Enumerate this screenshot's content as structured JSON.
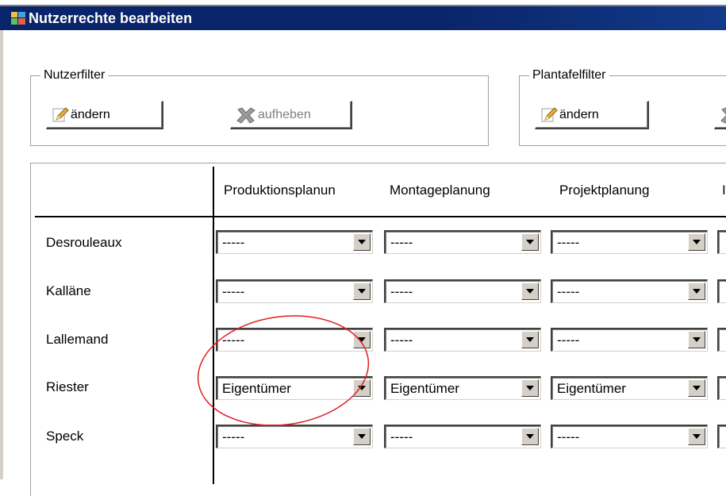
{
  "window": {
    "title": "Nutzerrechte bearbeiten",
    "icon": "app-grid-icon"
  },
  "filters": {
    "nutzerfilter": {
      "legend": "Nutzerfilter",
      "change_label": "ändern",
      "remove_label": "aufheben"
    },
    "plantafelfilter": {
      "legend": "Plantafelfilter",
      "change_label": "ändern"
    }
  },
  "grid": {
    "columns": [
      "Produktionsplanun",
      "Montageplanung",
      "Projektplanung"
    ],
    "rows": [
      {
        "name": "Desrouleaux",
        "values": [
          "-----",
          "-----",
          "-----"
        ]
      },
      {
        "name": "Kalläne",
        "values": [
          "-----",
          "-----",
          "-----"
        ]
      },
      {
        "name": "Lallemand",
        "values": [
          "-----",
          "-----",
          "-----"
        ]
      },
      {
        "name": "Riester",
        "values": [
          "Eigentümer",
          "Eigentümer",
          "Eigentümer"
        ]
      },
      {
        "name": "Speck",
        "values": [
          "-----",
          "-----",
          "-----"
        ]
      }
    ]
  },
  "annotation": {
    "color": "#e02020",
    "shape": "ellipse"
  },
  "colors": {
    "titlebar": "#0a246a",
    "face": "#d4d0c8"
  }
}
